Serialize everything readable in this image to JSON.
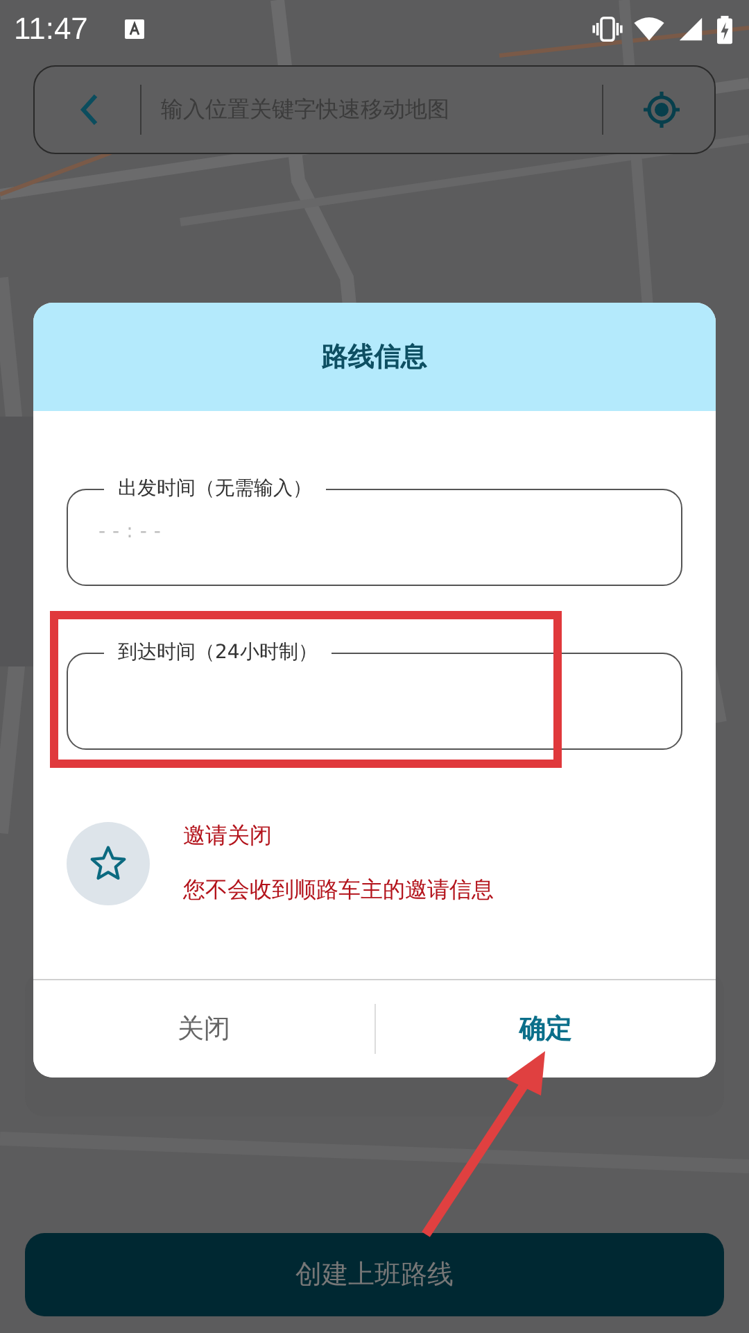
{
  "status_bar": {
    "time": "11:47"
  },
  "search_bar": {
    "placeholder": "输入位置关键字快速移动地图"
  },
  "dialog": {
    "title": "路线信息",
    "fields": [
      {
        "label": "出发时间（无需输入）",
        "placeholder": "--:--"
      },
      {
        "label": "到达时间（24小时制）"
      }
    ],
    "invite": {
      "title": "邀请关闭",
      "message": "您不会收到顺路车主的邀请信息"
    },
    "buttons": [
      {
        "label": "关闭",
        "kind": "cancel"
      },
      {
        "label": "确定",
        "kind": "confirm"
      }
    ]
  },
  "primary_button": {
    "label": "创建上班路线"
  }
}
